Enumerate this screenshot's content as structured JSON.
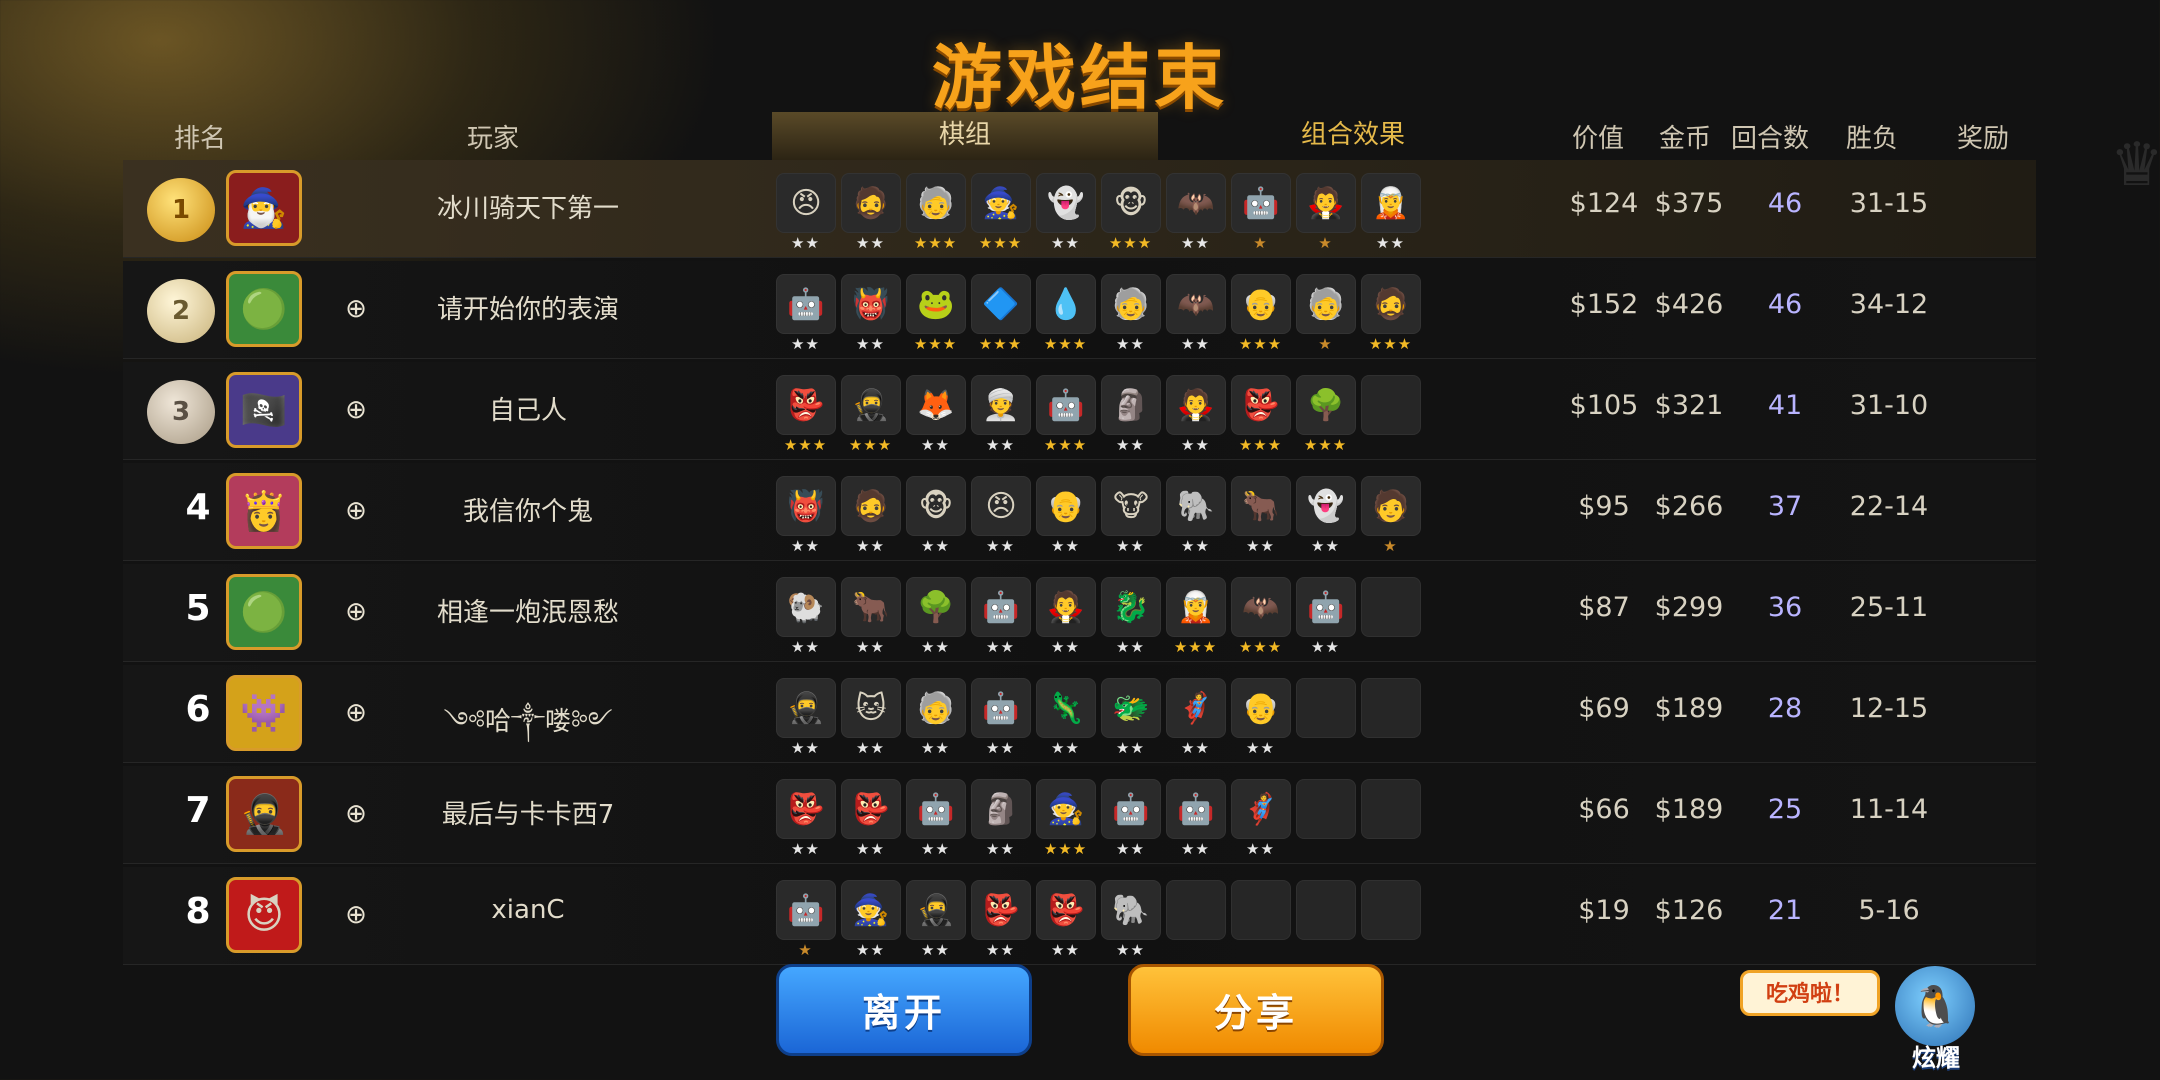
{
  "title": "游戏结束",
  "headers": {
    "rank": "排名",
    "player": "玩家",
    "lineup_tab": "棋组",
    "synergy_tab": "组合效果",
    "value": "价值",
    "gold": "金币",
    "rounds": "回合数",
    "wl": "胜负",
    "reward": "奖励"
  },
  "players": [
    {
      "rank": "1",
      "medal": "gold",
      "name": "冰川骑天下第一",
      "value": "$124",
      "gold": "$375",
      "rounds": "46",
      "wl": "31-15",
      "avatar_icon": "portrait-icon",
      "units": [
        {
          "icon": "😠",
          "stars": "★★"
        },
        {
          "icon": "🧔",
          "stars": "★★"
        },
        {
          "icon": "🧓",
          "stars": "★★★"
        },
        {
          "icon": "🧙",
          "stars": "★★★"
        },
        {
          "icon": "👻",
          "stars": "★★"
        },
        {
          "icon": "🐵",
          "stars": "★★★"
        },
        {
          "icon": "🦇",
          "stars": "★★"
        },
        {
          "icon": "🤖",
          "stars": "★"
        },
        {
          "icon": "🧛",
          "stars": "★"
        },
        {
          "icon": "🧝",
          "stars": "★★"
        }
      ]
    },
    {
      "rank": "2",
      "medal": "silver",
      "name": "请开始你的表演",
      "value": "$152",
      "gold": "$426",
      "rounds": "46",
      "wl": "34-12",
      "avatar_icon": "orc-icon",
      "units": [
        {
          "icon": "🤖",
          "stars": "★★"
        },
        {
          "icon": "👹",
          "stars": "★★"
        },
        {
          "icon": "🐸",
          "stars": "★★★"
        },
        {
          "icon": "🔷",
          "stars": "★★★"
        },
        {
          "icon": "💧",
          "stars": "★★★"
        },
        {
          "icon": "🧓",
          "stars": "★★"
        },
        {
          "icon": "🦇",
          "stars": "★★"
        },
        {
          "icon": "👴",
          "stars": "★★★"
        },
        {
          "icon": "🧓",
          "stars": "★"
        },
        {
          "icon": "🧔",
          "stars": "★★★"
        }
      ]
    },
    {
      "rank": "3",
      "medal": "bronze",
      "name": "自己人",
      "value": "$105",
      "gold": "$321",
      "rounds": "41",
      "wl": "31-10",
      "avatar_icon": "pirate-icon",
      "units": [
        {
          "icon": "👺",
          "stars": "★★★"
        },
        {
          "icon": "🥷",
          "stars": "★★★"
        },
        {
          "icon": "🦊",
          "stars": "★★"
        },
        {
          "icon": "👳",
          "stars": "★★"
        },
        {
          "icon": "🤖",
          "stars": "★★★"
        },
        {
          "icon": "🗿",
          "stars": "★★"
        },
        {
          "icon": "🧛",
          "stars": "★★"
        },
        {
          "icon": "👺",
          "stars": "★★★"
        },
        {
          "icon": "🌳",
          "stars": "★★★"
        },
        {
          "icon": "",
          "stars": ""
        }
      ]
    },
    {
      "rank": "4",
      "medal": "",
      "name": "我信你个鬼",
      "value": "$95",
      "gold": "$266",
      "rounds": "37",
      "wl": "22-14",
      "avatar_icon": "princess-icon",
      "units": [
        {
          "icon": "👹",
          "stars": "★★"
        },
        {
          "icon": "🧔",
          "stars": "★★"
        },
        {
          "icon": "🐵",
          "stars": "★★"
        },
        {
          "icon": "😠",
          "stars": "★★"
        },
        {
          "icon": "👴",
          "stars": "★★"
        },
        {
          "icon": "🐮",
          "stars": "★★"
        },
        {
          "icon": "🐘",
          "stars": "★★"
        },
        {
          "icon": "🐂",
          "stars": "★★"
        },
        {
          "icon": "👻",
          "stars": "★★"
        },
        {
          "icon": "🧑",
          "stars": "★"
        }
      ]
    },
    {
      "rank": "5",
      "medal": "",
      "name": "相逢一炮泯恩愁",
      "value": "$87",
      "gold": "$299",
      "rounds": "36",
      "wl": "25-11",
      "avatar_icon": "orc-icon",
      "units": [
        {
          "icon": "🐏",
          "stars": "★★"
        },
        {
          "icon": "🐂",
          "stars": "★★"
        },
        {
          "icon": "🌳",
          "stars": "★★"
        },
        {
          "icon": "🤖",
          "stars": "★★"
        },
        {
          "icon": "🧛",
          "stars": "★★"
        },
        {
          "icon": "🐉",
          "stars": "★★"
        },
        {
          "icon": "🧝",
          "stars": "★★★"
        },
        {
          "icon": "🦇",
          "stars": "★★★"
        },
        {
          "icon": "🤖",
          "stars": "★★"
        },
        {
          "icon": "",
          "stars": ""
        }
      ]
    },
    {
      "rank": "6",
      "medal": "",
      "name": "༺哈༒喽༻",
      "value": "$69",
      "gold": "$189",
      "rounds": "28",
      "wl": "12-15",
      "avatar_icon": "monster-icon",
      "units": [
        {
          "icon": "🥷",
          "stars": "★★"
        },
        {
          "icon": "🐱",
          "stars": "★★"
        },
        {
          "icon": "🧓",
          "stars": "★★"
        },
        {
          "icon": "🤖",
          "stars": "★★"
        },
        {
          "icon": "🦎",
          "stars": "★★"
        },
        {
          "icon": "🐲",
          "stars": "★★"
        },
        {
          "icon": "🦸",
          "stars": "★★"
        },
        {
          "icon": "👴",
          "stars": "★★"
        },
        {
          "icon": "",
          "stars": ""
        },
        {
          "icon": "",
          "stars": ""
        }
      ]
    },
    {
      "rank": "7",
      "medal": "",
      "name": "最后与卡卡西7",
      "value": "$66",
      "gold": "$189",
      "rounds": "25",
      "wl": "11-14",
      "avatar_icon": "bandit-icon",
      "units": [
        {
          "icon": "👺",
          "stars": "★★"
        },
        {
          "icon": "👺",
          "stars": "★★"
        },
        {
          "icon": "🤖",
          "stars": "★★"
        },
        {
          "icon": "🗿",
          "stars": "★★"
        },
        {
          "icon": "🧙",
          "stars": "★★★"
        },
        {
          "icon": "🤖",
          "stars": "★★"
        },
        {
          "icon": "🤖",
          "stars": "★★"
        },
        {
          "icon": "🦸",
          "stars": "★★"
        },
        {
          "icon": "",
          "stars": ""
        },
        {
          "icon": "",
          "stars": ""
        }
      ]
    },
    {
      "rank": "8",
      "medal": "",
      "name": "xianC",
      "value": "$19",
      "gold": "$126",
      "rounds": "21",
      "wl": "5-16",
      "avatar_icon": "devil-icon",
      "units": [
        {
          "icon": "🤖",
          "stars": "★"
        },
        {
          "icon": "🧙",
          "stars": "★★"
        },
        {
          "icon": "🥷",
          "stars": "★★"
        },
        {
          "icon": "👺",
          "stars": "★★"
        },
        {
          "icon": "👺",
          "stars": "★★"
        },
        {
          "icon": "🐘",
          "stars": "★★"
        },
        {
          "icon": "",
          "stars": ""
        },
        {
          "icon": "",
          "stars": ""
        },
        {
          "icon": "",
          "stars": ""
        },
        {
          "icon": "",
          "stars": ""
        }
      ]
    }
  ],
  "avatars": [
    "🧙‍♂️",
    "🟢",
    "🏴‍☠️",
    "👸",
    "🟢",
    "👾",
    "🥷",
    "😈"
  ],
  "buttons": {
    "leave": "离开",
    "share": "分享"
  },
  "bubble": "吃鸡啦！",
  "mascot_label": "炫耀",
  "colors": {
    "title": "#f7a21b",
    "accent_gold": "#c9a45a",
    "rounds_text": "#b9b4ff",
    "leave_button": "#1b66d6",
    "share_button": "#f08a00"
  }
}
